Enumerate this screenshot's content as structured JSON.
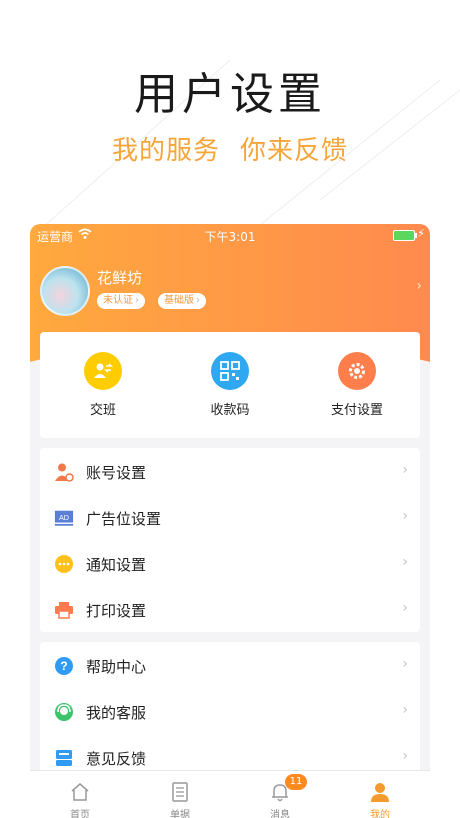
{
  "promo": {
    "headline": "用户设置",
    "tagline_1": "我的服务",
    "tagline_2": "你来反馈"
  },
  "status_bar": {
    "carrier": "运营商",
    "time": "下午3:01"
  },
  "profile": {
    "shop_name": "花鲜坊",
    "badge_verification": "未认证",
    "badge_plan": "基础版"
  },
  "quick_actions": [
    {
      "label": "交班",
      "icon": "shift-handover-icon",
      "color": "#ffcc00"
    },
    {
      "label": "收款码",
      "icon": "qr-code-icon",
      "color": "#2ea8f0"
    },
    {
      "label": "支付设置",
      "icon": "gear-icon",
      "color": "#ff7e4c"
    }
  ],
  "settings_group_1": [
    {
      "label": "账号设置",
      "icon": "user-account-icon",
      "color": "#f0784a"
    },
    {
      "label": "广告位设置",
      "icon": "ad-icon",
      "color": "#5b7fd6"
    },
    {
      "label": "通知设置",
      "icon": "chat-bubble-icon",
      "color": "#ffc21a"
    },
    {
      "label": "打印设置",
      "icon": "printer-icon",
      "color": "#ff7a4c"
    }
  ],
  "settings_group_2": [
    {
      "label": "帮助中心",
      "icon": "help-icon",
      "color": "#2f9bf2"
    },
    {
      "label": "我的客服",
      "icon": "customer-service-icon",
      "color": "#3cc46b"
    },
    {
      "label": "意见反馈",
      "icon": "feedback-icon",
      "color": "#2f9bf2"
    }
  ],
  "tab_bar": {
    "tabs": [
      {
        "label": "首页",
        "icon": "home-icon"
      },
      {
        "label": "单据",
        "icon": "document-icon"
      },
      {
        "label": "消息",
        "icon": "bell-icon",
        "badge": "11"
      },
      {
        "label": "我的",
        "icon": "person-icon"
      }
    ],
    "active_color": "#f39b2f"
  }
}
